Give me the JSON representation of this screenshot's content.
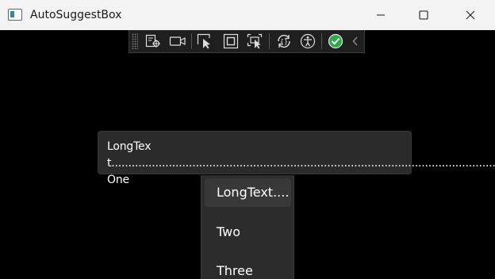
{
  "window": {
    "title": "AutoSuggestBox",
    "minimize_icon": "minimize-icon",
    "maximize_icon": "maximize-icon",
    "close_icon": "close-icon"
  },
  "toolbar": {
    "icons": [
      "visual-tree-icon",
      "record-icon",
      "select-element-icon",
      "display-layout-adorners-icon",
      "track-focused-element-icon",
      "hot-reload-icon",
      "accessibility-checker-icon",
      "no-issues-check-icon",
      "collapse-toolbar-chevron-icon"
    ],
    "accent_green": "#2ea84a"
  },
  "suggest_box": {
    "text": "LongText.....................................................................................................................One"
  },
  "suggestions": [
    "LongText....",
    "Two",
    "Three"
  ],
  "colors": {
    "background": "#000000",
    "titlebar": "#f3f3f3",
    "surface": "#2b2b2b",
    "text": "#ffffff"
  }
}
